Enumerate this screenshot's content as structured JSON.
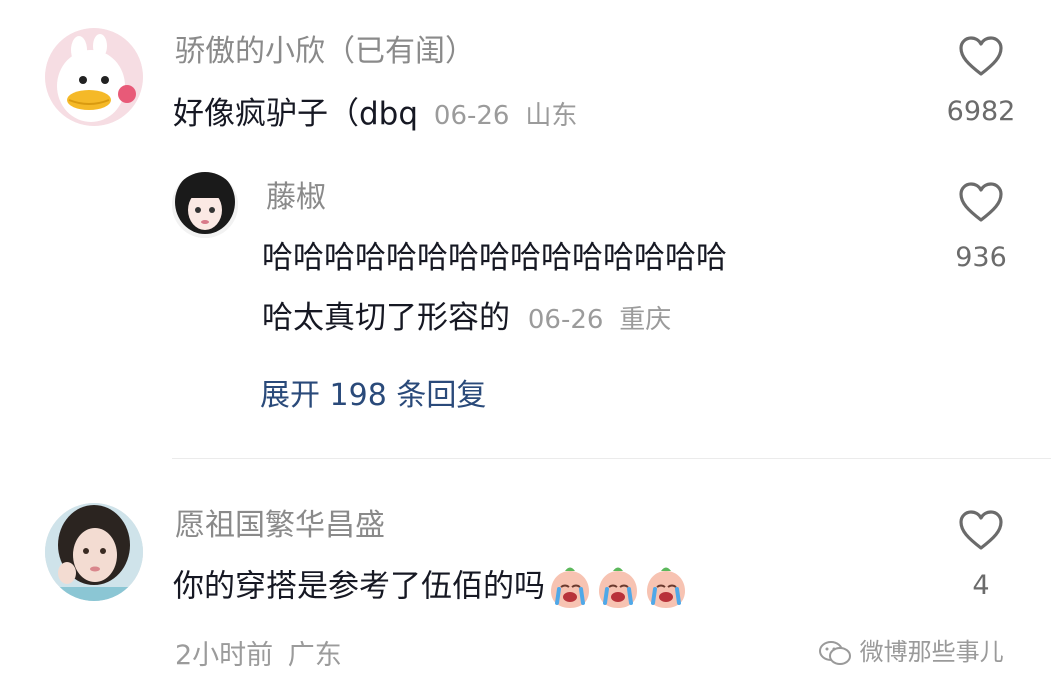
{
  "comments": [
    {
      "username": "骄傲的小欣（已有闺）",
      "text": "好像疯驴子（dbq",
      "date": "06-26",
      "location": "山东",
      "likes": "6982",
      "avatar_icon": "duck-avatar-icon"
    },
    {
      "username": "愿祖国繁华昌盛",
      "text": "你的穿搭是参考了伍佰的吗",
      "emoji_icon": "crying-peach-emoji-icon",
      "emoji_count": 3,
      "time": "2小时前",
      "location": "广东",
      "likes": "4",
      "avatar_icon": "girl-photo-avatar-icon"
    }
  ],
  "reply": {
    "username": "藤椒",
    "text_line1": "哈哈哈哈哈哈哈哈哈哈哈哈哈哈哈",
    "text_line2": "哈太真切了形容的",
    "date": "06-26",
    "location": "重庆",
    "likes": "936",
    "avatar_icon": "anime-girl-avatar-icon"
  },
  "expand_replies": "展开 198 条回复",
  "watermark": "微博那些事儿",
  "colors": {
    "username": "#8a8a8a",
    "text": "#161823",
    "meta": "#9b9b9b",
    "expand": "#2a4a7a",
    "divider": "#ebebeb"
  }
}
